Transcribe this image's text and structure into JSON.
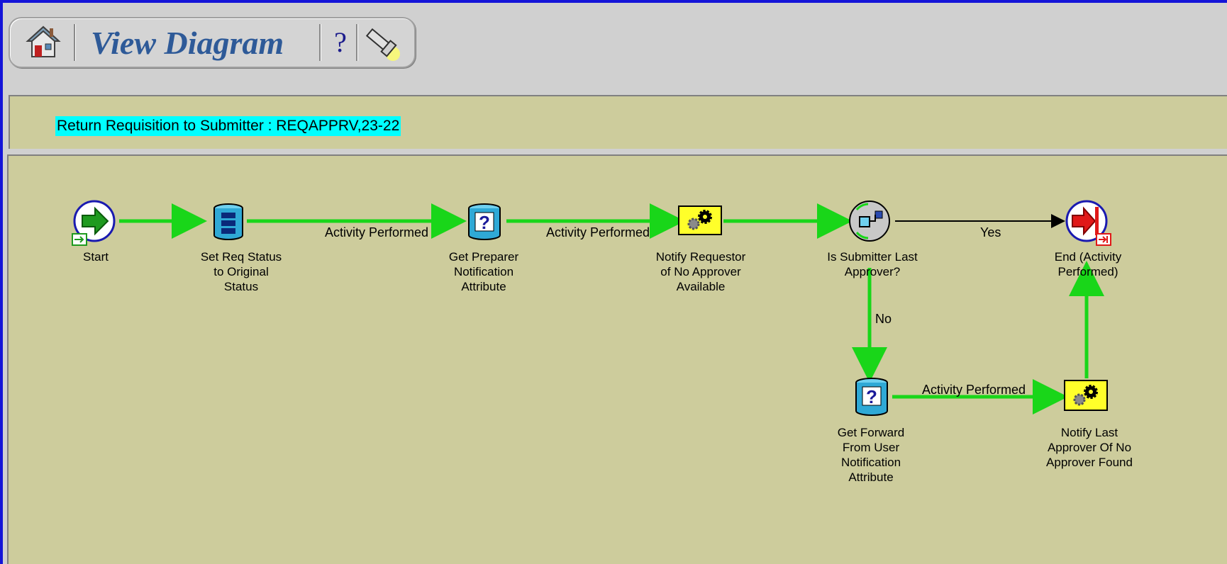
{
  "toolbar": {
    "title": "View Diagram",
    "help_label": "?"
  },
  "process": {
    "title": "Return Requisition to Submitter : REQAPPRV,23-22"
  },
  "nodes": {
    "start": "Start",
    "set_req_status": "Set Req Status\nto Original\nStatus",
    "get_preparer": "Get Preparer\nNotification\nAttribute",
    "notify_requestor": "Notify Requestor\nof No Approver\nAvailable",
    "is_submitter": "Is Submitter Last\nApprover?",
    "end": "End (Activity\nPerformed)",
    "get_forward": "Get Forward\nFrom User\nNotification\nAttribute",
    "notify_last": "Notify Last\nApprover Of No\nApprover Found"
  },
  "edges": {
    "e1": "Activity Performed",
    "e2": "Activity Performed",
    "yes": "Yes",
    "no": "No",
    "e3": "Activity Performed"
  },
  "colors": {
    "background_frame": "#1414d8",
    "panel": "#cdcc9c",
    "transition": "#19d619",
    "highlight": "#00ffff"
  }
}
